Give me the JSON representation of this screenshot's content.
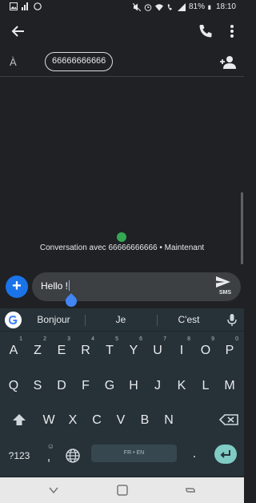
{
  "statusbar": {
    "battery": "81%",
    "time": "18:10"
  },
  "recipients": {
    "to_label": "À",
    "chip": "66666666666"
  },
  "conversation": {
    "info": "Conversation avec 66666666666 • Maintenant"
  },
  "compose": {
    "text": "Hello !",
    "send_label": "SMS"
  },
  "keyboard": {
    "suggestions": [
      "Bonjour",
      "Je",
      "C'est"
    ],
    "row1": [
      {
        "k": "A",
        "s": "1"
      },
      {
        "k": "Z",
        "s": "2"
      },
      {
        "k": "E",
        "s": "3"
      },
      {
        "k": "R",
        "s": "4"
      },
      {
        "k": "T",
        "s": "5"
      },
      {
        "k": "Y",
        "s": "6"
      },
      {
        "k": "U",
        "s": "7"
      },
      {
        "k": "I",
        "s": "8"
      },
      {
        "k": "O",
        "s": "9"
      },
      {
        "k": "P",
        "s": "0"
      }
    ],
    "row2": [
      "Q",
      "S",
      "D",
      "F",
      "G",
      "H",
      "J",
      "K",
      "L",
      "M"
    ],
    "row3": [
      "W",
      "X",
      "C",
      "V",
      "B",
      "N"
    ],
    "symbols_key": "?123",
    "comma_key": ",",
    "emoji_key": "☺",
    "space_label": "FR • EN",
    "period_key": "."
  },
  "colors": {
    "accent": "#1a73e8",
    "enter": "#80cbc4",
    "presence": "#34a853"
  }
}
